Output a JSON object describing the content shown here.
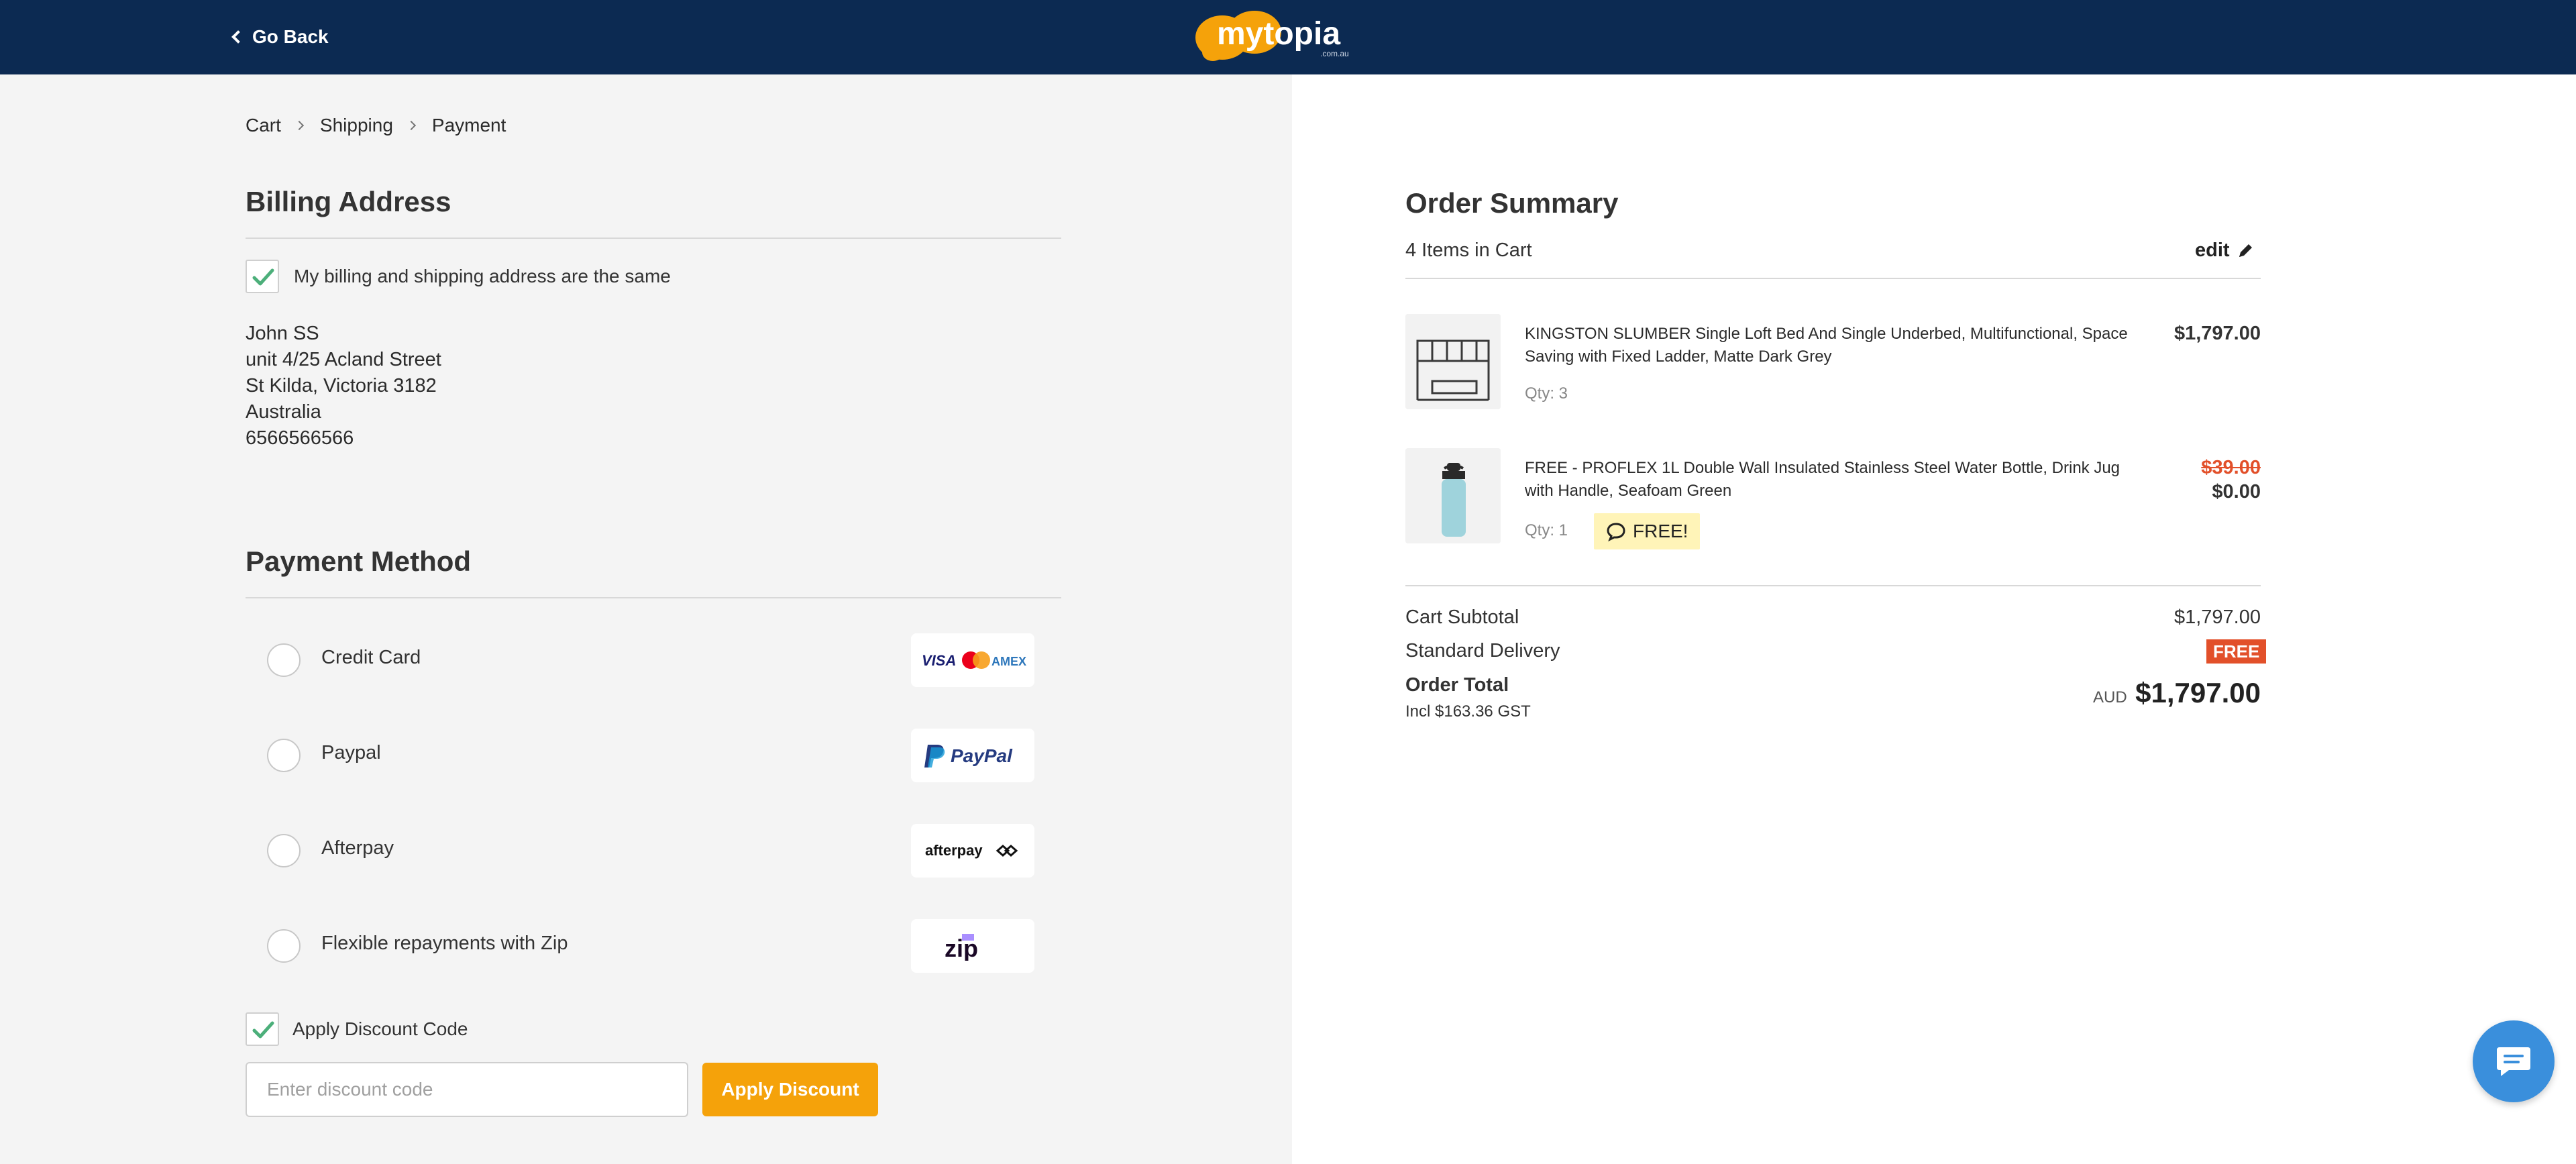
{
  "header": {
    "go_back": "Go Back",
    "brand": "mytopia",
    "brand_sub": ".com.au"
  },
  "breadcrumb": [
    "Cart",
    "Shipping",
    "Payment"
  ],
  "billing": {
    "title": "Billing Address",
    "same_label": "My billing and shipping address are the same",
    "same_checked": true,
    "name": "John SS",
    "line1": "unit 4/25 Acland Street",
    "line2": "St Kilda, Victoria 3182",
    "country": "Australia",
    "phone": "6566566566"
  },
  "payment": {
    "title": "Payment Method",
    "methods": [
      {
        "label": "Credit Card",
        "icon": "card-brands-icon"
      },
      {
        "label": "Paypal",
        "icon": "paypal-icon"
      },
      {
        "label": "Afterpay",
        "icon": "afterpay-icon"
      },
      {
        "label": "Flexible repayments with Zip",
        "icon": "zip-icon"
      }
    ],
    "card_brands": [
      "VISA",
      "AMEX"
    ],
    "paypal_text": "PayPal",
    "afterpay_text": "afterpay",
    "zip_text": "zip"
  },
  "discount": {
    "checkbox_label": "Apply Discount Code",
    "checked": true,
    "placeholder": "Enter discount code",
    "button": "Apply Discount"
  },
  "summary": {
    "title": "Order Summary",
    "items_count": "4 Items in Cart",
    "edit": "edit",
    "items": [
      {
        "name": "KINGSTON SLUMBER Single Loft Bed And Single Underbed, Multifunctional, Space Saving with Fixed Ladder, Matte Dark Grey",
        "qty": "Qty: 3",
        "price": "$1,797.00",
        "image": "bunk-bed-thumbnail"
      },
      {
        "name": "FREE - PROFLEX 1L Double Wall Insulated Stainless Steel Water Bottle, Drink Jug with Handle, Seafoam Green",
        "qty": "Qty: 1",
        "original_price": "$39.00",
        "price": "$0.00",
        "badge": "FREE!",
        "image": "water-bottle-thumbnail"
      }
    ],
    "subtotal_label": "Cart Subtotal",
    "subtotal": "$1,797.00",
    "delivery_label": "Standard Delivery",
    "delivery": "FREE",
    "total_label": "Order Total",
    "gst": "Incl $163.36 GST",
    "currency": "AUD",
    "total": "$1,797.00"
  },
  "colors": {
    "header_bg": "#0c2a52",
    "accent": "#f5a20a",
    "check": "#4caf7a",
    "free_tag": "#e2502a",
    "chat": "#3a8fdc"
  }
}
